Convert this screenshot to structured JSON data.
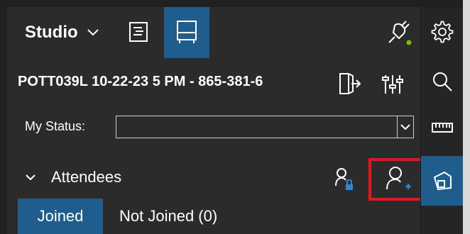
{
  "header": {
    "studio_label": "Studio",
    "studio_chevron_icon": "chevron-down-icon",
    "list_icon": "list-panel-icon",
    "whiteboard_icon": "whiteboard-icon",
    "connection_icon": "plug-connection-icon",
    "connection_status_color": "#7fba00"
  },
  "meeting": {
    "title": "POTT039L 10-22-23 5 PM - 865-381-6",
    "exit_icon": "exit-door-icon",
    "mixer_icon": "audio-mixer-icon"
  },
  "status": {
    "label": "My Status:",
    "value": "",
    "dropdown_icon": "chevron-down-icon"
  },
  "attendees": {
    "label": "Attendees",
    "expand_icon": "chevron-down-icon",
    "lock_person_icon": "person-lock-icon",
    "add_person_icon": "add-person-icon"
  },
  "tabs": [
    {
      "label": "Joined",
      "active": true
    },
    {
      "label": "Not Joined (0)",
      "active": false
    }
  ],
  "sidebar": {
    "items": [
      {
        "icon": "gear-icon"
      },
      {
        "icon": "search-icon"
      },
      {
        "icon": "ruler-icon"
      },
      {
        "icon": "shape-icon",
        "active": true
      }
    ]
  },
  "colors": {
    "panel_background": "#2b2b2b",
    "accent_blue": "#1f5e8c",
    "highlight_red": "#e0191f",
    "text": "#ffffff"
  }
}
